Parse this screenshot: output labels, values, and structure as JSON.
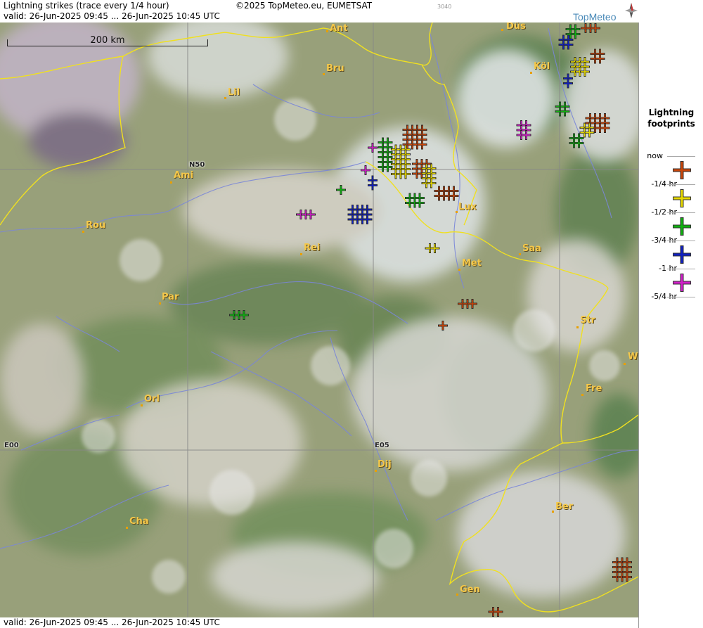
{
  "header": {
    "title": "Lightning strikes (trace every 1/4 hour)",
    "copyright": "©2025 TopMeteo.eu, EUMETSAT",
    "code": "3040",
    "valid": "valid:  26-Jun-2025 09:45 ... 26-Jun-2025 10:45 UTC",
    "logo_text": "TopMeteo"
  },
  "footer": {
    "valid": "valid:  26-Jun-2025 09:45 ... 26-Jun-2025 10:45 UTC"
  },
  "scale": {
    "label": "200 km"
  },
  "grid_labels": {
    "n50": "N50",
    "e00": "E00",
    "e05": "E05"
  },
  "cities": [
    {
      "name": "Ant"
    },
    {
      "name": "Düs"
    },
    {
      "name": "Bru"
    },
    {
      "name": "Köl"
    },
    {
      "name": "Lil"
    },
    {
      "name": "Ami"
    },
    {
      "name": "Lux"
    },
    {
      "name": "Rou"
    },
    {
      "name": "Rei"
    },
    {
      "name": "Saa"
    },
    {
      "name": "Met"
    },
    {
      "name": "Par"
    },
    {
      "name": "Str"
    },
    {
      "name": "W"
    },
    {
      "name": "Fre"
    },
    {
      "name": "Orl"
    },
    {
      "name": "Dij"
    },
    {
      "name": "Ber"
    },
    {
      "name": "Cha"
    },
    {
      "name": "Gen"
    }
  ],
  "legend": {
    "title_line1": "Lightning",
    "title_line2": "footprints",
    "items": [
      {
        "label": "now",
        "color": ""
      },
      {
        "label": "-1/4 hr",
        "color": "#c8460a"
      },
      {
        "label": "-1/2 hr",
        "color": "#e6d800"
      },
      {
        "label": "-3/4 hr",
        "color": "#10b010"
      },
      {
        "label": "-1 hr",
        "color": "#1020c0"
      },
      {
        "label": "-5/4 hr",
        "color": "#d020c8"
      }
    ]
  },
  "colors": {
    "border": "#f0e020",
    "river": "#7a86d8",
    "grid": "#888888",
    "city_label": "#f5c84a"
  }
}
